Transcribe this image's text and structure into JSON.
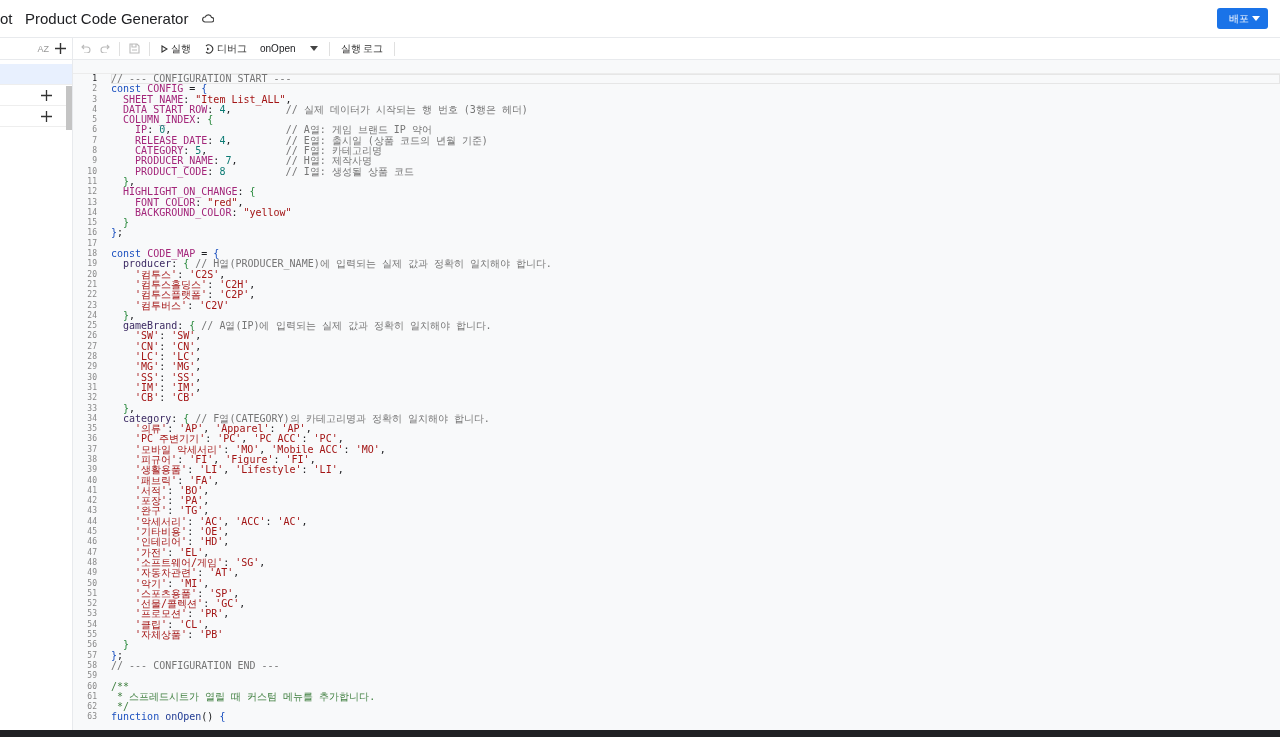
{
  "header": {
    "product_name_fragment": "ot",
    "project_title": "Product Code Generator",
    "deploy_button": "배포"
  },
  "toolbar": {
    "sort_label": "AZ",
    "undo_disabled": true,
    "redo_disabled": true,
    "save_disabled": true,
    "run": "실행",
    "debug": "디버그",
    "function_select": {
      "value": "onOpen"
    },
    "execution_log": "실행 로그"
  },
  "sidebar": {
    "items": [
      {
        "kind": "file",
        "selected": true
      },
      {
        "kind": "section",
        "selected": false
      },
      {
        "kind": "section",
        "selected": false
      }
    ]
  },
  "editor": {
    "lines": [
      {
        "number": "1",
        "active": true,
        "tokens": [
          {
            "kind": "comment",
            "text": "// --- CONFIGURATION START ---"
          }
        ]
      },
      {
        "number": "2",
        "active": false,
        "tokens": [
          {
            "kind": "keyword",
            "text": "const "
          },
          {
            "kind": "property",
            "text": "CONFIG"
          },
          {
            "kind": "plain",
            "text": " = "
          },
          {
            "kind": "bracket_outer",
            "text": "{"
          }
        ]
      },
      {
        "number": "3",
        "active": false,
        "tokens": [
          {
            "kind": "property",
            "text": "  SHEET_NAME"
          },
          {
            "kind": "plain",
            "text": ": "
          },
          {
            "kind": "string",
            "text": "\"Item List_ALL\""
          },
          {
            "kind": "plain",
            "text": ","
          }
        ]
      },
      {
        "number": "4",
        "active": false,
        "tokens": [
          {
            "kind": "property",
            "text": "  DATA_START_ROW"
          },
          {
            "kind": "plain",
            "text": ": "
          },
          {
            "kind": "number",
            "text": "4"
          },
          {
            "kind": "plain",
            "text": ",         "
          },
          {
            "kind": "comment",
            "text": "// 실제 데이터가 시작되는 행 번호 (3행은 헤더)"
          }
        ]
      },
      {
        "number": "5",
        "active": false,
        "tokens": [
          {
            "kind": "property",
            "text": "  COLUMN_INDEX"
          },
          {
            "kind": "plain",
            "text": ": "
          },
          {
            "kind": "bracket_inner",
            "text": "{"
          }
        ]
      },
      {
        "number": "6",
        "active": false,
        "tokens": [
          {
            "kind": "property",
            "text": "    IP"
          },
          {
            "kind": "plain",
            "text": ": "
          },
          {
            "kind": "number",
            "text": "0"
          },
          {
            "kind": "plain",
            "text": ",                   "
          },
          {
            "kind": "comment",
            "text": "// A열: 게임 브랜드 IP 약어"
          }
        ]
      },
      {
        "number": "7",
        "active": false,
        "tokens": [
          {
            "kind": "property",
            "text": "    RELEASE_DATE"
          },
          {
            "kind": "plain",
            "text": ": "
          },
          {
            "kind": "number",
            "text": "4"
          },
          {
            "kind": "plain",
            "text": ",         "
          },
          {
            "kind": "comment",
            "text": "// E열: 출시일 (상품 코드의 년월 기준)"
          }
        ]
      },
      {
        "number": "8",
        "active": false,
        "tokens": [
          {
            "kind": "property",
            "text": "    CATEGORY"
          },
          {
            "kind": "plain",
            "text": ": "
          },
          {
            "kind": "number",
            "text": "5"
          },
          {
            "kind": "plain",
            "text": ",             "
          },
          {
            "kind": "comment",
            "text": "// F열: 카테고리명"
          }
        ]
      },
      {
        "number": "9",
        "active": false,
        "tokens": [
          {
            "kind": "property",
            "text": "    PRODUCER_NAME"
          },
          {
            "kind": "plain",
            "text": ": "
          },
          {
            "kind": "number",
            "text": "7"
          },
          {
            "kind": "plain",
            "text": ",        "
          },
          {
            "kind": "comment",
            "text": "// H열: 제작사명"
          }
        ]
      },
      {
        "number": "10",
        "active": false,
        "tokens": [
          {
            "kind": "property",
            "text": "    PRODUCT_CODE"
          },
          {
            "kind": "plain",
            "text": ": "
          },
          {
            "kind": "number",
            "text": "8"
          },
          {
            "kind": "comment",
            "text": "          // I열: 생성될 상품 코드"
          }
        ]
      },
      {
        "number": "11",
        "active": false,
        "tokens": [
          {
            "kind": "bracket_inner",
            "text": "  }"
          },
          {
            "kind": "plain",
            "text": ","
          }
        ]
      },
      {
        "number": "12",
        "active": false,
        "tokens": [
          {
            "kind": "property",
            "text": "  HIGHLIGHT_ON_CHANGE"
          },
          {
            "kind": "plain",
            "text": ": "
          },
          {
            "kind": "bracket_inner",
            "text": "{"
          }
        ]
      },
      {
        "number": "13",
        "active": false,
        "tokens": [
          {
            "kind": "property",
            "text": "    FONT_COLOR"
          },
          {
            "kind": "plain",
            "text": ": "
          },
          {
            "kind": "string",
            "text": "\"red\""
          },
          {
            "kind": "plain",
            "text": ","
          }
        ]
      },
      {
        "number": "14",
        "active": false,
        "tokens": [
          {
            "kind": "property",
            "text": "    BACKGROUND_COLOR"
          },
          {
            "kind": "plain",
            "text": ": "
          },
          {
            "kind": "string",
            "text": "\"yellow\""
          }
        ]
      },
      {
        "number": "15",
        "active": false,
        "tokens": [
          {
            "kind": "bracket_inner",
            "text": "  }"
          }
        ]
      },
      {
        "number": "16",
        "active": false,
        "tokens": [
          {
            "kind": "bracket_outer",
            "text": "}"
          },
          {
            "kind": "plain",
            "text": ";"
          }
        ]
      },
      {
        "number": "17",
        "active": false
      },
      {
        "number": "18",
        "active": false,
        "tokens": [
          {
            "kind": "keyword",
            "text": "const "
          },
          {
            "kind": "property",
            "text": "CODE_MAP"
          },
          {
            "kind": "plain",
            "text": " = "
          },
          {
            "kind": "bracket_outer",
            "text": "{"
          }
        ]
      },
      {
        "number": "19",
        "active": false,
        "tokens": [
          {
            "kind": "key",
            "text": "  producer"
          },
          {
            "kind": "plain",
            "text": ": "
          },
          {
            "kind": "bracket_inner",
            "text": "{ "
          },
          {
            "kind": "comment",
            "text": "// H열(PRODUCER_NAME)에 입력되는 실제 값과 정확히 일치해야 합니다."
          }
        ]
      },
      {
        "number": "20",
        "active": false,
        "tokens": [
          {
            "kind": "string",
            "text": "    '컴투스'"
          },
          {
            "kind": "plain",
            "text": ": "
          },
          {
            "kind": "string",
            "text": "'C2S'"
          },
          {
            "kind": "plain",
            "text": ","
          }
        ]
      },
      {
        "number": "21",
        "active": false,
        "tokens": [
          {
            "kind": "string",
            "text": "    '컴투스홀딩스'"
          },
          {
            "kind": "plain",
            "text": ": "
          },
          {
            "kind": "string",
            "text": "'C2H'"
          },
          {
            "kind": "plain",
            "text": ","
          }
        ]
      },
      {
        "number": "22",
        "active": false,
        "tokens": [
          {
            "kind": "string",
            "text": "    '컴투스플랫폼'"
          },
          {
            "kind": "plain",
            "text": ": "
          },
          {
            "kind": "string",
            "text": "'C2P'"
          },
          {
            "kind": "plain",
            "text": ","
          }
        ]
      },
      {
        "number": "23",
        "active": false,
        "tokens": [
          {
            "kind": "string",
            "text": "    '컴투버스'"
          },
          {
            "kind": "plain",
            "text": ": "
          },
          {
            "kind": "string",
            "text": "'C2V'"
          }
        ]
      },
      {
        "number": "24",
        "active": false,
        "tokens": [
          {
            "kind": "bracket_inner",
            "text": "  }"
          },
          {
            "kind": "plain",
            "text": ","
          }
        ]
      },
      {
        "number": "25",
        "active": false,
        "tokens": [
          {
            "kind": "key",
            "text": "  gameBrand"
          },
          {
            "kind": "plain",
            "text": ": "
          },
          {
            "kind": "bracket_inner",
            "text": "{ "
          },
          {
            "kind": "comment",
            "text": "// A열(IP)에 입력되는 실제 값과 정확히 일치해야 합니다."
          }
        ]
      },
      {
        "number": "26",
        "active": false,
        "tokens": [
          {
            "kind": "string",
            "text": "    'SW'"
          },
          {
            "kind": "plain",
            "text": ": "
          },
          {
            "kind": "string",
            "text": "'SW'"
          },
          {
            "kind": "plain",
            "text": ","
          }
        ]
      },
      {
        "number": "27",
        "active": false,
        "tokens": [
          {
            "kind": "string",
            "text": "    'CN'"
          },
          {
            "kind": "plain",
            "text": ": "
          },
          {
            "kind": "string",
            "text": "'CN'"
          },
          {
            "kind": "plain",
            "text": ","
          }
        ]
      },
      {
        "number": "28",
        "active": false,
        "tokens": [
          {
            "kind": "string",
            "text": "    'LC'"
          },
          {
            "kind": "plain",
            "text": ": "
          },
          {
            "kind": "string",
            "text": "'LC'"
          },
          {
            "kind": "plain",
            "text": ","
          }
        ]
      },
      {
        "number": "29",
        "active": false,
        "tokens": [
          {
            "kind": "string",
            "text": "    'MG'"
          },
          {
            "kind": "plain",
            "text": ": "
          },
          {
            "kind": "string",
            "text": "'MG'"
          },
          {
            "kind": "plain",
            "text": ","
          }
        ]
      },
      {
        "number": "30",
        "active": false,
        "tokens": [
          {
            "kind": "string",
            "text": "    'SS'"
          },
          {
            "kind": "plain",
            "text": ": "
          },
          {
            "kind": "string",
            "text": "'SS'"
          },
          {
            "kind": "plain",
            "text": ","
          }
        ]
      },
      {
        "number": "31",
        "active": false,
        "tokens": [
          {
            "kind": "string",
            "text": "    'IM'"
          },
          {
            "kind": "plain",
            "text": ": "
          },
          {
            "kind": "string",
            "text": "'IM'"
          },
          {
            "kind": "plain",
            "text": ","
          }
        ]
      },
      {
        "number": "32",
        "active": false,
        "tokens": [
          {
            "kind": "string",
            "text": "    'CB'"
          },
          {
            "kind": "plain",
            "text": ": "
          },
          {
            "kind": "string",
            "text": "'CB'"
          }
        ]
      },
      {
        "number": "33",
        "active": false,
        "tokens": [
          {
            "kind": "bracket_inner",
            "text": "  }"
          },
          {
            "kind": "plain",
            "text": ","
          }
        ]
      },
      {
        "number": "34",
        "active": false,
        "tokens": [
          {
            "kind": "key",
            "text": "  category"
          },
          {
            "kind": "plain",
            "text": ": "
          },
          {
            "kind": "bracket_inner",
            "text": "{ "
          },
          {
            "kind": "comment",
            "text": "// F열(CATEGORY)의 카테고리명과 정확히 일치해야 합니다."
          }
        ]
      },
      {
        "number": "35",
        "active": false,
        "tokens": [
          {
            "kind": "string",
            "text": "    '의류'"
          },
          {
            "kind": "plain",
            "text": ": "
          },
          {
            "kind": "string",
            "text": "'AP'"
          },
          {
            "kind": "plain",
            "text": ", "
          },
          {
            "kind": "string",
            "text": "'Apparel'"
          },
          {
            "kind": "plain",
            "text": ": "
          },
          {
            "kind": "string",
            "text": "'AP'"
          },
          {
            "kind": "plain",
            "text": ","
          }
        ]
      },
      {
        "number": "36",
        "active": false,
        "tokens": [
          {
            "kind": "string",
            "text": "    'PC 주변기기'"
          },
          {
            "kind": "plain",
            "text": ": "
          },
          {
            "kind": "string",
            "text": "'PC'"
          },
          {
            "kind": "plain",
            "text": ", "
          },
          {
            "kind": "string",
            "text": "'PC ACC'"
          },
          {
            "kind": "plain",
            "text": ": "
          },
          {
            "kind": "string",
            "text": "'PC'"
          },
          {
            "kind": "plain",
            "text": ","
          }
        ]
      },
      {
        "number": "37",
        "active": false,
        "tokens": [
          {
            "kind": "string",
            "text": "    '모바일 악세서리'"
          },
          {
            "kind": "plain",
            "text": ": "
          },
          {
            "kind": "string",
            "text": "'MO'"
          },
          {
            "kind": "plain",
            "text": ", "
          },
          {
            "kind": "string",
            "text": "'Mobile ACC'"
          },
          {
            "kind": "plain",
            "text": ": "
          },
          {
            "kind": "string",
            "text": "'MO'"
          },
          {
            "kind": "plain",
            "text": ","
          }
        ]
      },
      {
        "number": "38",
        "active": false,
        "tokens": [
          {
            "kind": "string",
            "text": "    '피규어'"
          },
          {
            "kind": "plain",
            "text": ": "
          },
          {
            "kind": "string",
            "text": "'FI'"
          },
          {
            "kind": "plain",
            "text": ", "
          },
          {
            "kind": "string",
            "text": "'Figure'"
          },
          {
            "kind": "plain",
            "text": ": "
          },
          {
            "kind": "string",
            "text": "'FI'"
          },
          {
            "kind": "plain",
            "text": ","
          }
        ]
      },
      {
        "number": "39",
        "active": false,
        "tokens": [
          {
            "kind": "string",
            "text": "    '생활용품'"
          },
          {
            "kind": "plain",
            "text": ": "
          },
          {
            "kind": "string",
            "text": "'LI'"
          },
          {
            "kind": "plain",
            "text": ", "
          },
          {
            "kind": "string",
            "text": "'Lifestyle'"
          },
          {
            "kind": "plain",
            "text": ": "
          },
          {
            "kind": "string",
            "text": "'LI'"
          },
          {
            "kind": "plain",
            "text": ","
          }
        ]
      },
      {
        "number": "40",
        "active": false,
        "tokens": [
          {
            "kind": "string",
            "text": "    '패브릭'"
          },
          {
            "kind": "plain",
            "text": ": "
          },
          {
            "kind": "string",
            "text": "'FA'"
          },
          {
            "kind": "plain",
            "text": ","
          }
        ]
      },
      {
        "number": "41",
        "active": false,
        "tokens": [
          {
            "kind": "string",
            "text": "    '서적'"
          },
          {
            "kind": "plain",
            "text": ": "
          },
          {
            "kind": "string",
            "text": "'BO'"
          },
          {
            "kind": "plain",
            "text": ","
          }
        ]
      },
      {
        "number": "42",
        "active": false,
        "tokens": [
          {
            "kind": "string",
            "text": "    '포장'"
          },
          {
            "kind": "plain",
            "text": ": "
          },
          {
            "kind": "string",
            "text": "'PA'"
          },
          {
            "kind": "plain",
            "text": ","
          }
        ]
      },
      {
        "number": "43",
        "active": false,
        "tokens": [
          {
            "kind": "string",
            "text": "    '완구'"
          },
          {
            "kind": "plain",
            "text": ": "
          },
          {
            "kind": "string",
            "text": "'TG'"
          },
          {
            "kind": "plain",
            "text": ","
          }
        ]
      },
      {
        "number": "44",
        "active": false,
        "tokens": [
          {
            "kind": "string",
            "text": "    '악세서리'"
          },
          {
            "kind": "plain",
            "text": ": "
          },
          {
            "kind": "string",
            "text": "'AC'"
          },
          {
            "kind": "plain",
            "text": ", "
          },
          {
            "kind": "string",
            "text": "'ACC'"
          },
          {
            "kind": "plain",
            "text": ": "
          },
          {
            "kind": "string",
            "text": "'AC'"
          },
          {
            "kind": "plain",
            "text": ","
          }
        ]
      },
      {
        "number": "45",
        "active": false,
        "tokens": [
          {
            "kind": "string",
            "text": "    '기타비용'"
          },
          {
            "kind": "plain",
            "text": ": "
          },
          {
            "kind": "string",
            "text": "'OE'"
          },
          {
            "kind": "plain",
            "text": ","
          }
        ]
      },
      {
        "number": "46",
        "active": false,
        "tokens": [
          {
            "kind": "string",
            "text": "    '인테리어'"
          },
          {
            "kind": "plain",
            "text": ": "
          },
          {
            "kind": "string",
            "text": "'HD'"
          },
          {
            "kind": "plain",
            "text": ","
          }
        ]
      },
      {
        "number": "47",
        "active": false,
        "tokens": [
          {
            "kind": "string",
            "text": "    '가전'"
          },
          {
            "kind": "plain",
            "text": ": "
          },
          {
            "kind": "string",
            "text": "'EL'"
          },
          {
            "kind": "plain",
            "text": ","
          }
        ]
      },
      {
        "number": "48",
        "active": false,
        "tokens": [
          {
            "kind": "string",
            "text": "    '소프트웨어/게임'"
          },
          {
            "kind": "plain",
            "text": ": "
          },
          {
            "kind": "string",
            "text": "'SG'"
          },
          {
            "kind": "plain",
            "text": ","
          }
        ]
      },
      {
        "number": "49",
        "active": false,
        "tokens": [
          {
            "kind": "string",
            "text": "    '자동차관련'"
          },
          {
            "kind": "plain",
            "text": ": "
          },
          {
            "kind": "string",
            "text": "'AT'"
          },
          {
            "kind": "plain",
            "text": ","
          }
        ]
      },
      {
        "number": "50",
        "active": false,
        "tokens": [
          {
            "kind": "string",
            "text": "    '악기'"
          },
          {
            "kind": "plain",
            "text": ": "
          },
          {
            "kind": "string",
            "text": "'MI'"
          },
          {
            "kind": "plain",
            "text": ","
          }
        ]
      },
      {
        "number": "51",
        "active": false,
        "tokens": [
          {
            "kind": "string",
            "text": "    '스포츠용품'"
          },
          {
            "kind": "plain",
            "text": ": "
          },
          {
            "kind": "string",
            "text": "'SP'"
          },
          {
            "kind": "plain",
            "text": ","
          }
        ]
      },
      {
        "number": "52",
        "active": false,
        "tokens": [
          {
            "kind": "string",
            "text": "    '선물/콜렉션'"
          },
          {
            "kind": "plain",
            "text": ": "
          },
          {
            "kind": "string",
            "text": "'GC'"
          },
          {
            "kind": "plain",
            "text": ","
          }
        ]
      },
      {
        "number": "53",
        "active": false,
        "tokens": [
          {
            "kind": "string",
            "text": "    '프로모션'"
          },
          {
            "kind": "plain",
            "text": ": "
          },
          {
            "kind": "string",
            "text": "'PR'"
          },
          {
            "kind": "plain",
            "text": ","
          }
        ]
      },
      {
        "number": "54",
        "active": false,
        "tokens": [
          {
            "kind": "string",
            "text": "    '클립'"
          },
          {
            "kind": "plain",
            "text": ": "
          },
          {
            "kind": "string",
            "text": "'CL'"
          },
          {
            "kind": "plain",
            "text": ","
          }
        ]
      },
      {
        "number": "55",
        "active": false,
        "tokens": [
          {
            "kind": "string",
            "text": "    '자체상품'"
          },
          {
            "kind": "plain",
            "text": ": "
          },
          {
            "kind": "string",
            "text": "'PB'"
          }
        ]
      },
      {
        "number": "56",
        "active": false,
        "tokens": [
          {
            "kind": "bracket_inner",
            "text": "  }"
          }
        ]
      },
      {
        "number": "57",
        "active": false,
        "tokens": [
          {
            "kind": "bracket_outer",
            "text": "}"
          },
          {
            "kind": "plain",
            "text": ";"
          }
        ]
      },
      {
        "number": "58",
        "active": false,
        "tokens": [
          {
            "kind": "comment",
            "text": "// --- CONFIGURATION END ---"
          }
        ]
      },
      {
        "number": "59",
        "active": false
      },
      {
        "number": "60",
        "active": false,
        "tokens": [
          {
            "kind": "doc",
            "text": "/**"
          }
        ]
      },
      {
        "number": "61",
        "active": false,
        "tokens": [
          {
            "kind": "doc",
            "text": " * 스프레드시트가 열릴 때 커스텀 메뉴를 추가합니다."
          }
        ]
      },
      {
        "number": "62",
        "active": false,
        "tokens": [
          {
            "kind": "doc",
            "text": " */"
          }
        ]
      },
      {
        "number": "63",
        "active": false,
        "tokens": [
          {
            "kind": "keyword",
            "text": "function "
          },
          {
            "kind": "function",
            "text": "onOpen"
          },
          {
            "kind": "plain",
            "text": "() "
          },
          {
            "kind": "bracket_outer",
            "text": "{"
          }
        ]
      }
    ]
  }
}
